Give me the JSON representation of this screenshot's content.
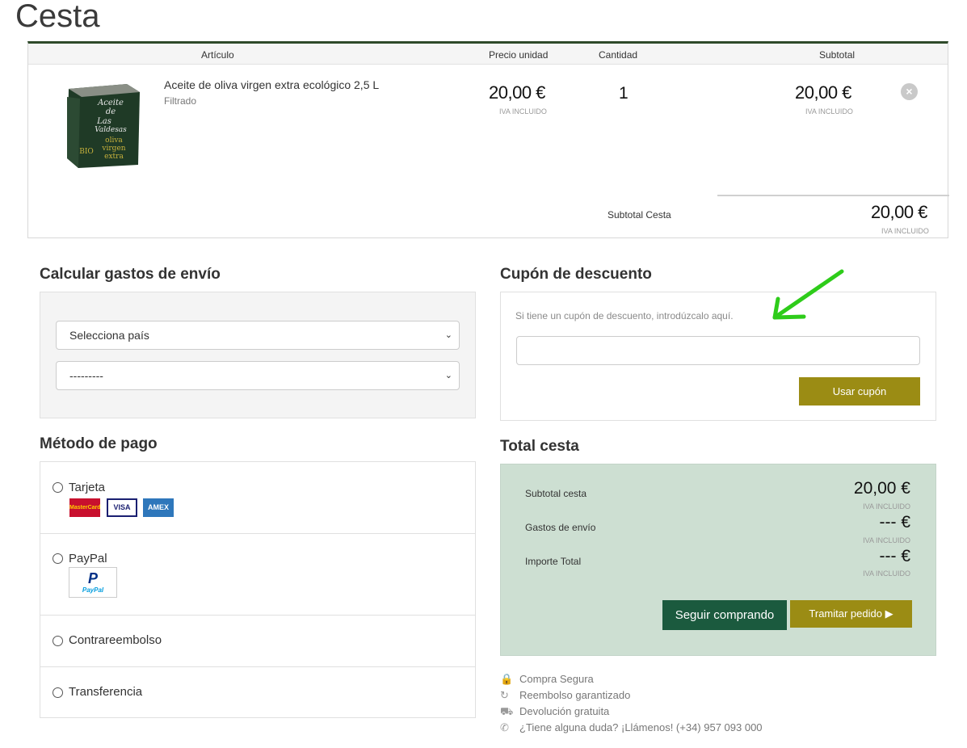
{
  "page": {
    "title": "Cesta"
  },
  "cart": {
    "headers": {
      "article": "Artículo",
      "unit_price": "Precio unidad",
      "quantity": "Cantidad",
      "subtotal": "Subtotal"
    },
    "item": {
      "name": "Aceite de oliva virgen extra ecológico 2,5 L",
      "variant": "Filtrado",
      "unit_price": "20,00 €",
      "unit_price_note": "IVA INCLUIDO",
      "quantity": "1",
      "subtotal": "20,00 €",
      "subtotal_note": "IVA INCLUIDO",
      "image_text": [
        "Aceite",
        "de",
        "Las",
        "Valdesas",
        "oliva",
        "virgen",
        "extra",
        "BIO"
      ]
    },
    "subtotal_label": "Subtotal Cesta",
    "subtotal_value": "20,00 €",
    "subtotal_note": "IVA INCLUIDO"
  },
  "shipping": {
    "title": "Calcular gastos de envío",
    "country_select": "Selecciona país",
    "region_select": "---------"
  },
  "coupon": {
    "title": "Cupón de descuento",
    "hint": "Si tiene un cupón de descuento, introdúzcalo aquí.",
    "value": "",
    "button": "Usar cupón"
  },
  "payment": {
    "title": "Método de pago",
    "methods": [
      {
        "label": "Tarjeta",
        "logos": [
          "MasterCard",
          "VISA",
          "AMEX"
        ]
      },
      {
        "label": "PayPal",
        "logo": "PayPal"
      },
      {
        "label": "Contrareembolso"
      },
      {
        "label": "Transferencia"
      }
    ]
  },
  "totals": {
    "title": "Total cesta",
    "rows": [
      {
        "label": "Subtotal cesta",
        "value": "20,00 €",
        "note": "IVA INCLUIDO"
      },
      {
        "label": "Gastos de envío",
        "value": "--- €",
        "note": "IVA INCLUIDO"
      },
      {
        "label": "Importe Total",
        "value": "--- €",
        "note": "IVA INCLUIDO"
      }
    ],
    "continue_button": "Seguir comprando",
    "checkout_button": "Tramitar pedido ▶"
  },
  "features": [
    {
      "icon": "lock-icon",
      "text": "Compra Segura"
    },
    {
      "icon": "refresh-icon",
      "text": "Reembolso garantizado"
    },
    {
      "icon": "truck-icon",
      "text": "Devolución gratuita"
    },
    {
      "icon": "phone-icon",
      "text": "¿Tiene alguna duda? ¡Llámenos! (+34) 957 093 000"
    }
  ],
  "colors": {
    "accent_olive": "#9b8c14",
    "dark_green": "#1b5a3e",
    "total_bg": "#cddfd2",
    "annotation_arrow": "#2ecc1a"
  }
}
